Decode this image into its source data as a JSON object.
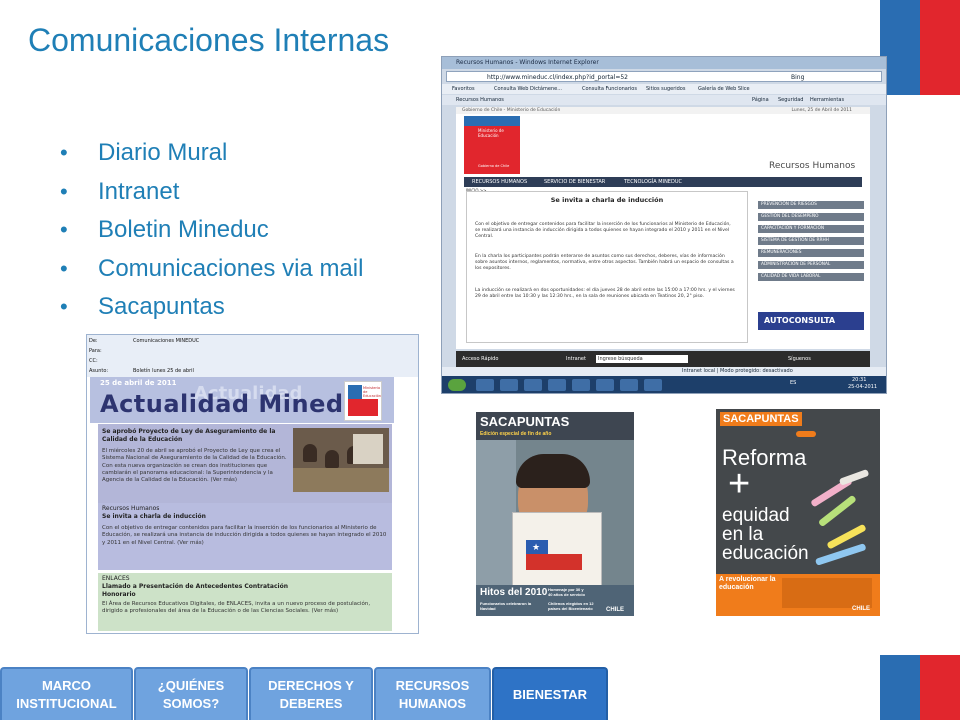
{
  "slide": {
    "title": "Comunicaciones Internas",
    "bullets": [
      "Diario Mural",
      "Intranet",
      "Boletin Mineduc",
      "Comunicaciones via mail",
      "Sacapuntas"
    ]
  },
  "colors": {
    "accent_blue": "#1f7fb6",
    "flag_blue": "#2a6db2",
    "flag_red": "#e1262d",
    "nav_button": "#6fa3df"
  },
  "intranet_screenshot": {
    "window_title": "Recursos Humanos - Windows Internet Explorer",
    "url": "http://www.mineduc.cl/index.php?id_portal=52",
    "search_engine": "Bing",
    "favorites": [
      "Favoritos",
      "Consulta Web Dictámene...",
      "Consulta Funcionarios",
      "Sitios sugeridos",
      "Galería de Web Slice"
    ],
    "tab": "Recursos Humanos",
    "toolbar_right": [
      "Página",
      "Seguridad",
      "Herramientas"
    ],
    "gov_line": "Gobierno de Chile - Ministerio de Educación",
    "page_date": "Lunes, 25 de Abril de 2011",
    "logo_text": "Ministerio de Educación",
    "logo_sub": "Gobierno de Chile",
    "section_title": "Recursos Humanos",
    "nav": [
      "RECURSOS HUMANOS",
      "SERVICIO DE BIENESTAR",
      "TECNOLOGÍA MINEDUC"
    ],
    "breadcrumb": "INICIO >>",
    "article_title": "Se invita a charla de inducción",
    "paragraphs": [
      "Con el objetivo de entregar contenidos para facilitar la inserción de los funcionarios al Ministerio de Educación, se realizará una instancia de inducción dirigida a todos quienes se hayan integrado el 2010 y 2011 en el Nivel Central.",
      "En la charla los participantes podrán enterarse de asuntos como sus derechos, deberes, vías de información sobre asuntos internos, reglamentos, normativa, entre otros aspectos. También habrá un espacio de consultas a los expositores.",
      "La inducción se realizará en dos oportunidades: el día jueves 28 de abril entre las 15:00 a 17:00 hrs. y el viernes 29 de abril entre las 10:30 y las 12:30 hrs., en la sala de reuniones ubicada en Teatinos 20, 2° piso."
    ],
    "side_menu": [
      "PREVENCIÓN DE RIESGOS",
      "GESTIÓN DEL DESEMPEÑO",
      "CAPACITACIÓN Y FORMACIÓN",
      "SISTEMA DE GESTIÓN DE RRHH",
      "REMUNERACIONES",
      "ADMINISTRACIÓN DE PERSONAL",
      "CALIDAD DE VIDA LABORAL"
    ],
    "autoconsulta": "AUTOCONSULTA",
    "footer_left": "Acceso Rápido",
    "footer_intranet": "Intranet",
    "footer_search": "Ingrese búsqueda",
    "footer_right": "Síguenos",
    "status": "Intranet local | Modo protegido: desactivado",
    "lang": "ES",
    "clock_time": "20:31",
    "clock_date": "25-04-2011"
  },
  "email_screenshot": {
    "header": [
      {
        "k": "De:",
        "v": "Comunicaciones MINEDUC"
      },
      {
        "k": "Para:",
        "v": ""
      },
      {
        "k": "CC:",
        "v": ""
      },
      {
        "k": "Asunto:",
        "v": "Boletín lunes 25 de abril"
      }
    ],
    "banner_date": "25 de abril de 2011",
    "banner_title": "Actualidad Mineduc",
    "banner_ghost": "Actualidad",
    "logo_text": "Ministerio de Educación",
    "card1_title": "Se aprobó Proyecto de Ley de Aseguramiento de la Calidad de la Educación",
    "card1_body": "El miércoles 20 de abril se aprobó el Proyecto de Ley que crea el Sistema Nacional de Aseguramiento de la Calidad de la Educación. Con esta nueva organización se crean dos instituciones que cambiarán el panorama educacional: la Superintendencia y la Agencia de la Calidad de la Educación. (Ver más)",
    "card2_kicker": "Recursos Humanos",
    "card2_title": "Se invita a charla de inducción",
    "card2_body": "Con el objetivo de entregar contenidos para facilitar la inserción de los funcionarios al Ministerio de Educación, se realizará una instancia de inducción dirigida a todos quienes se hayan integrado el 2010 y 2011 en el Nivel Central. (Ver más)",
    "card3_kicker": "ENLACES",
    "card3_title": "Llamado a Presentación de Antecedentes Contratación Honorario",
    "card3_body": "El Área de Recursos Educativos Digitales, de ENLACES, invita a un nuevo proceso de postulación, dirigido a profesionales del área de la Educación o de las Ciencias Sociales. (Ver más)"
  },
  "cover1": {
    "brand": "SACAPUNTAS",
    "subtitle": "Edición especial de fin de año",
    "hitos": "Hitos del 2010",
    "blurbs": [
      "Homenaje por 30 y 40 años de servicio",
      "Funcionarios celebraron la Navidad",
      "Chilenos elegidos en 12 países del Bicentenario"
    ],
    "footer_logo": "CHILE"
  },
  "cover2": {
    "brand": "SACAPUNTAS",
    "reforma": "Reforma",
    "plus": "+",
    "equidad": [
      "equidad",
      "en la",
      "educación"
    ],
    "bottom": "A revolucionar la educación",
    "footer_logo": "CHILE"
  },
  "nav_buttons": [
    {
      "label": "MARCO INSTITUCIONAL"
    },
    {
      "label": "¿QUIÉNES SOMOS?"
    },
    {
      "label": "DERECHOS Y DEBERES"
    },
    {
      "label": "RECURSOS HUMANOS"
    },
    {
      "label": "BIENESTAR"
    }
  ]
}
